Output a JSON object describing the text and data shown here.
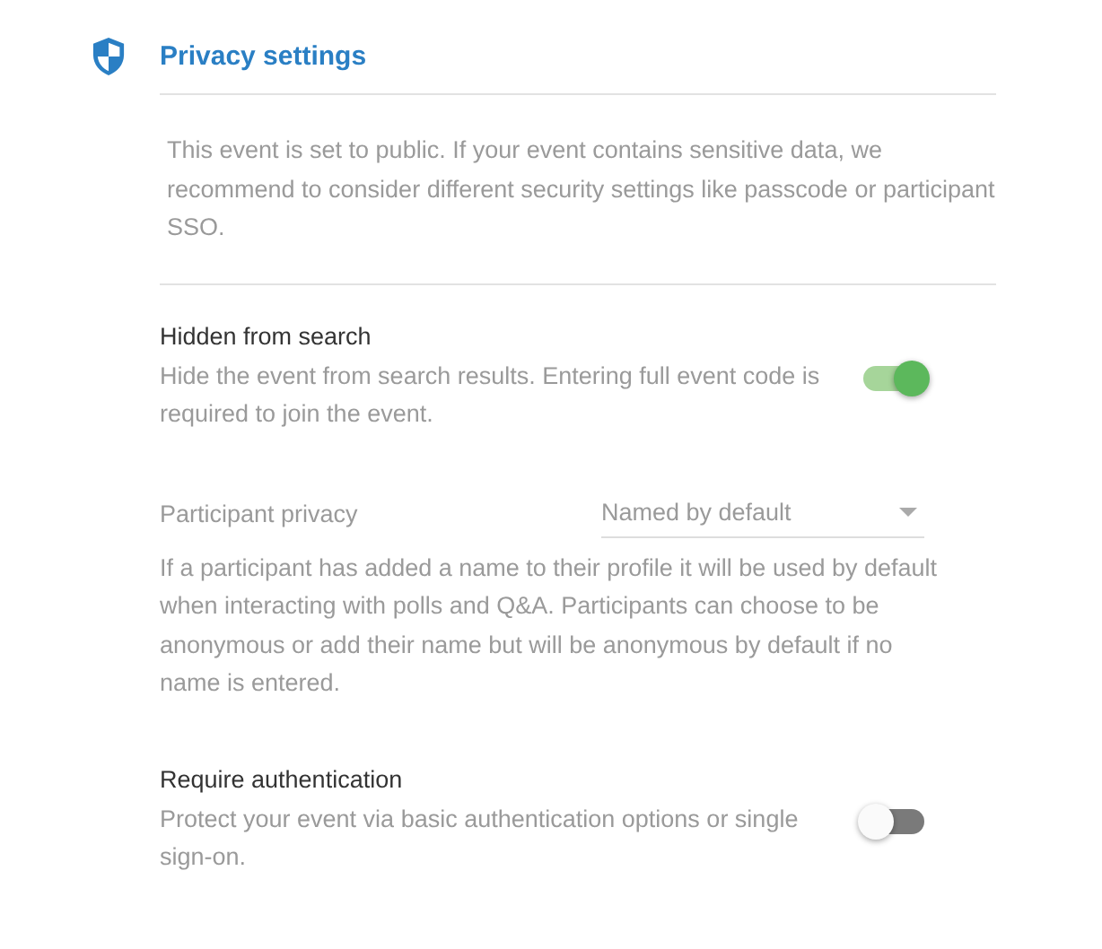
{
  "section": {
    "title": "Privacy settings"
  },
  "notice": "This event is set to public. If your event contains sensitive data, we recommend to consider different security settings like passcode or participant SSO.",
  "settings": [
    {
      "kind": "toggle",
      "label": "Hidden from search",
      "description": "Hide the event from search results. Entering full event code is required to join the event.",
      "on": true
    },
    {
      "kind": "select",
      "label": "Participant privacy",
      "value": "Named by default",
      "disabled": true,
      "description": "If a participant has added a name to their profile it will be used by default when interacting with polls and Q&A. Participants can choose to be anonymous or add their name but will be anonymous by default if no name is entered."
    },
    {
      "kind": "toggle",
      "label": "Require authentication",
      "description": "Protect your event via basic authentication options or single sign-on.",
      "on": false
    }
  ]
}
